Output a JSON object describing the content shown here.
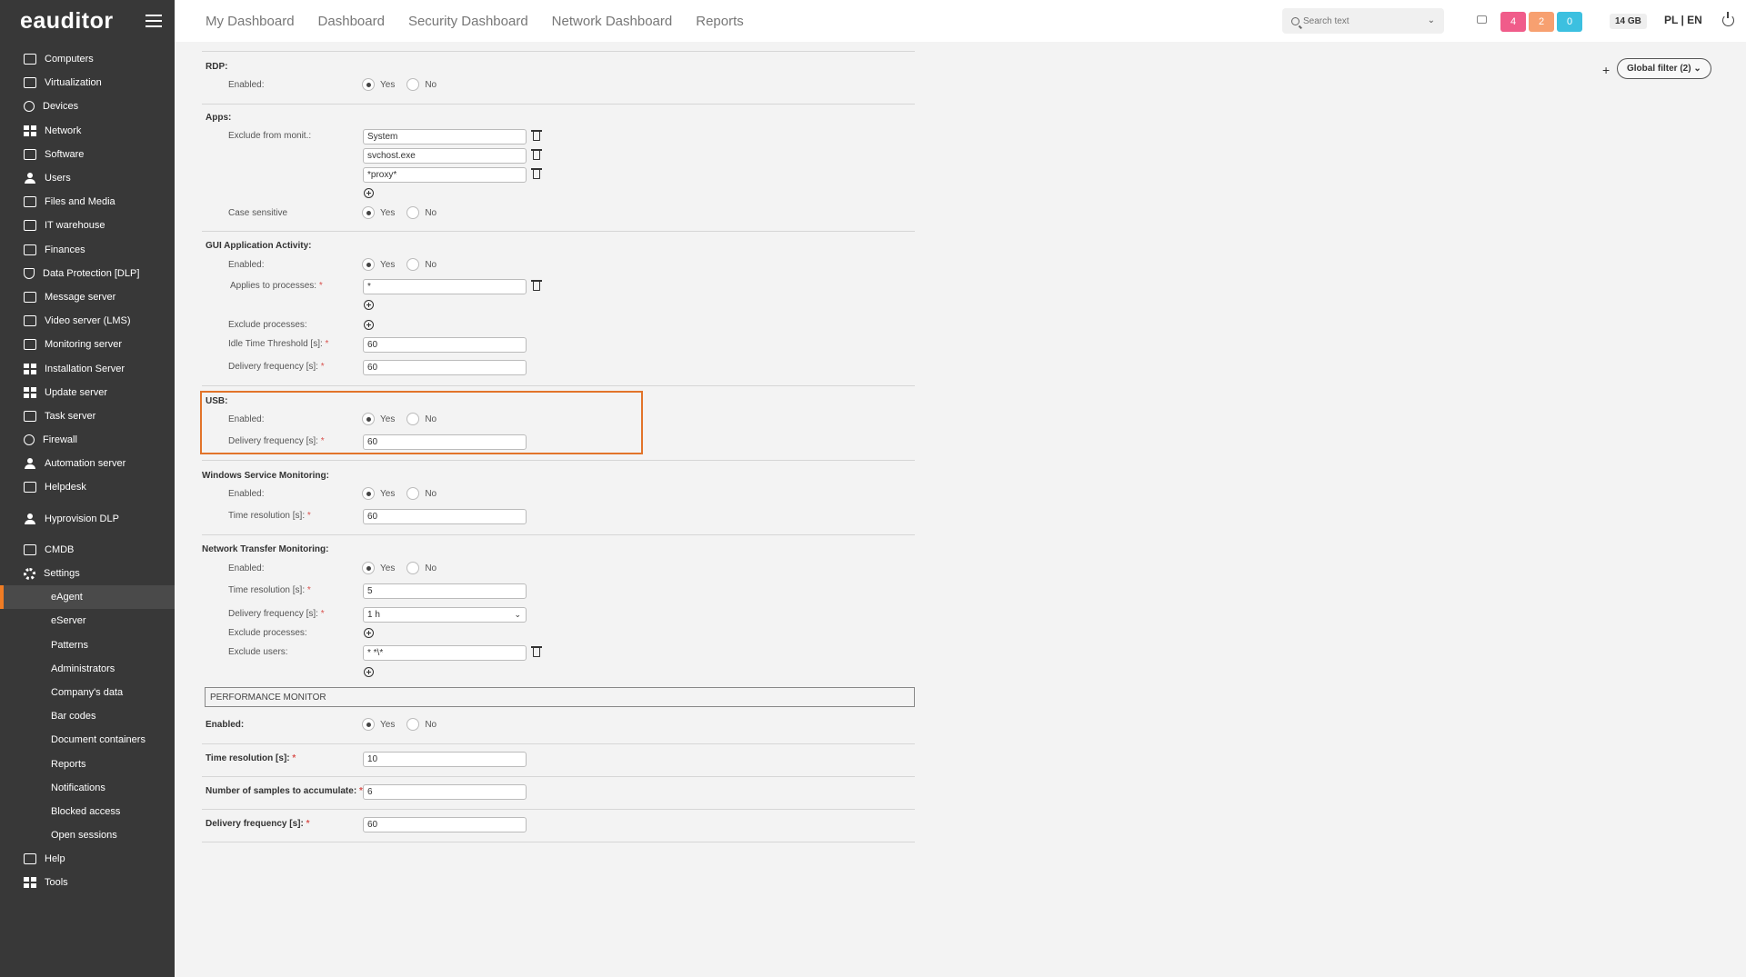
{
  "app": {
    "logo": "eauditor"
  },
  "topnav": [
    "My Dashboard",
    "Dashboard",
    "Security Dashboard",
    "Network Dashboard",
    "Reports"
  ],
  "search": {
    "placeholder": "Search text"
  },
  "badges": [
    {
      "value": "4",
      "color": "#f05c8a"
    },
    {
      "value": "2",
      "color": "#f7a070"
    },
    {
      "value": "0",
      "color": "#3cc0e0"
    }
  ],
  "disk": "14 GB",
  "lang": "PL | EN",
  "global_filter": {
    "plus": "+",
    "label": "Global filter (2)"
  },
  "sidebar": {
    "items": [
      "Computers",
      "Virtualization",
      "Devices",
      "Network",
      "Software",
      "Users",
      "Files and Media",
      "IT warehouse",
      "Finances",
      "Data Protection [DLP]",
      "Message server",
      "Video server (LMS)",
      "Monitoring server",
      "Installation Server",
      "Update server",
      "Task server",
      "Firewall",
      "Automation server",
      "Helpdesk"
    ],
    "items2": [
      "Hyprovision DLP"
    ],
    "items3": [
      "CMDB",
      "Settings"
    ],
    "settings_sub": [
      "eAgent",
      "eServer",
      "Patterns",
      "Administrators",
      "Company's data",
      "Bar codes",
      "Document containers",
      "Reports",
      "Notifications",
      "Blocked access",
      "Open sessions"
    ],
    "items4": [
      "Help",
      "Tools"
    ]
  },
  "common": {
    "yes": "Yes",
    "no": "No",
    "req": "*"
  },
  "rdp": {
    "title": "RDP:",
    "enabled": "Enabled:"
  },
  "apps": {
    "title": "Apps:",
    "exclude_label": "Exclude from monit.:",
    "exclude_values": [
      "System",
      "svchost.exe",
      "*proxy*"
    ],
    "case_label": "Case sensitive"
  },
  "gui": {
    "title": "GUI Application Activity:",
    "enabled": "Enabled:",
    "applies_label": "Applies to processes:",
    "applies_value": "*",
    "exclude_label": "Exclude processes:",
    "idle_label": "Idle Time Threshold [s]:",
    "idle_value": "60",
    "delivery_label": "Delivery frequency [s]:",
    "delivery_value": "60"
  },
  "usb": {
    "title": "USB:",
    "enabled": "Enabled:",
    "delivery_label": "Delivery frequency [s]:",
    "delivery_value": "60"
  },
  "winsvc": {
    "title": "Windows Service Monitoring:",
    "enabled": "Enabled:",
    "time_label": "Time resolution [s]:",
    "time_value": "60"
  },
  "nettransfer": {
    "title": "Network Transfer Monitoring:",
    "enabled": "Enabled:",
    "time_label": "Time resolution [s]:",
    "time_value": "5",
    "delivery_label": "Delivery frequency [s]:",
    "delivery_value": "1 h",
    "exclude_proc_label": "Exclude processes:",
    "exclude_users_label": "Exclude users:",
    "exclude_users_value": "* *\\*"
  },
  "perf": {
    "header": "PERFORMANCE MONITOR",
    "enabled": "Enabled:",
    "time_label": "Time resolution [s]:",
    "time_value": "10",
    "samples_label": "Number of samples to accumulate:",
    "samples_value": "6",
    "delivery_label": "Delivery frequency [s]:",
    "delivery_value": "60"
  }
}
